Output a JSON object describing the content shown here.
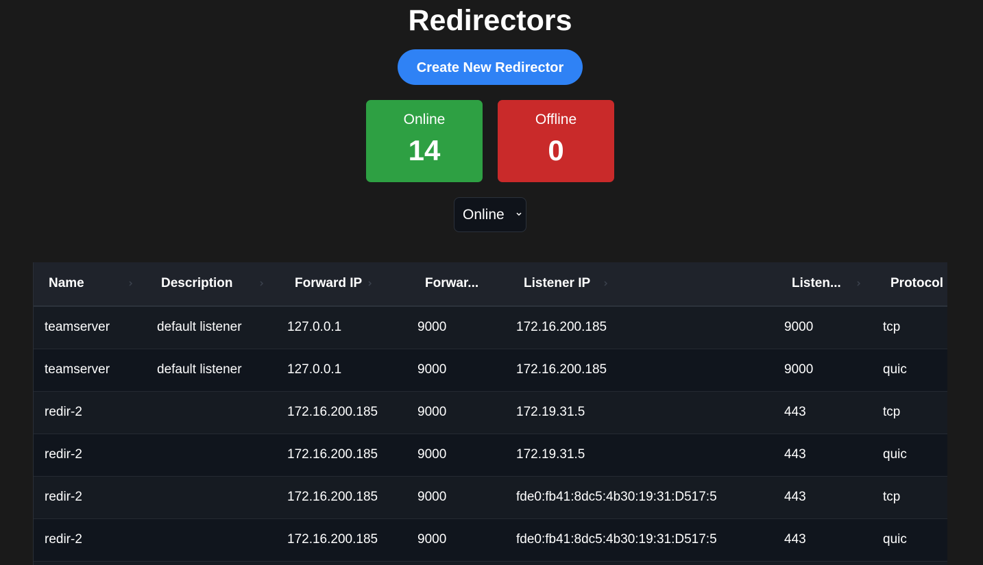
{
  "header": {
    "title": "Redirectors",
    "create_button_label": "Create New Redirector"
  },
  "stats": {
    "online": {
      "label": "Online",
      "count": "14",
      "color": "#2ea043"
    },
    "offline": {
      "label": "Offline",
      "count": "0",
      "color": "#c92a2a"
    }
  },
  "filter": {
    "selected": "Online",
    "icon": "chevron-down-icon"
  },
  "table": {
    "columns": [
      "Name",
      "Description",
      "Forward IP",
      "Forwar...",
      "Listener IP",
      "Listen...",
      "Protocol"
    ],
    "rows": [
      [
        "teamserver",
        "default listener",
        "127.0.0.1",
        "9000",
        "172.16.200.185",
        "9000",
        "tcp"
      ],
      [
        "teamserver",
        "default listener",
        "127.0.0.1",
        "9000",
        "172.16.200.185",
        "9000",
        "quic"
      ],
      [
        "redir-2",
        "",
        "172.16.200.185",
        "9000",
        "172.19.31.5",
        "443",
        "tcp"
      ],
      [
        "redir-2",
        "",
        "172.16.200.185",
        "9000",
        "172.19.31.5",
        "443",
        "quic"
      ],
      [
        "redir-2",
        "",
        "172.16.200.185",
        "9000",
        "fde0:fb41:8dc5:4b30:19:31:D517:5",
        "443",
        "tcp"
      ],
      [
        "redir-2",
        "",
        "172.16.200.185",
        "9000",
        "fde0:fb41:8dc5:4b30:19:31:D517:5",
        "443",
        "quic"
      ]
    ]
  },
  "colors": {
    "background": "#1a1a1a",
    "accent": "#2f82f5",
    "table_header": "#1f232b",
    "row_odd": "#161b22",
    "row_even": "#10151d"
  }
}
